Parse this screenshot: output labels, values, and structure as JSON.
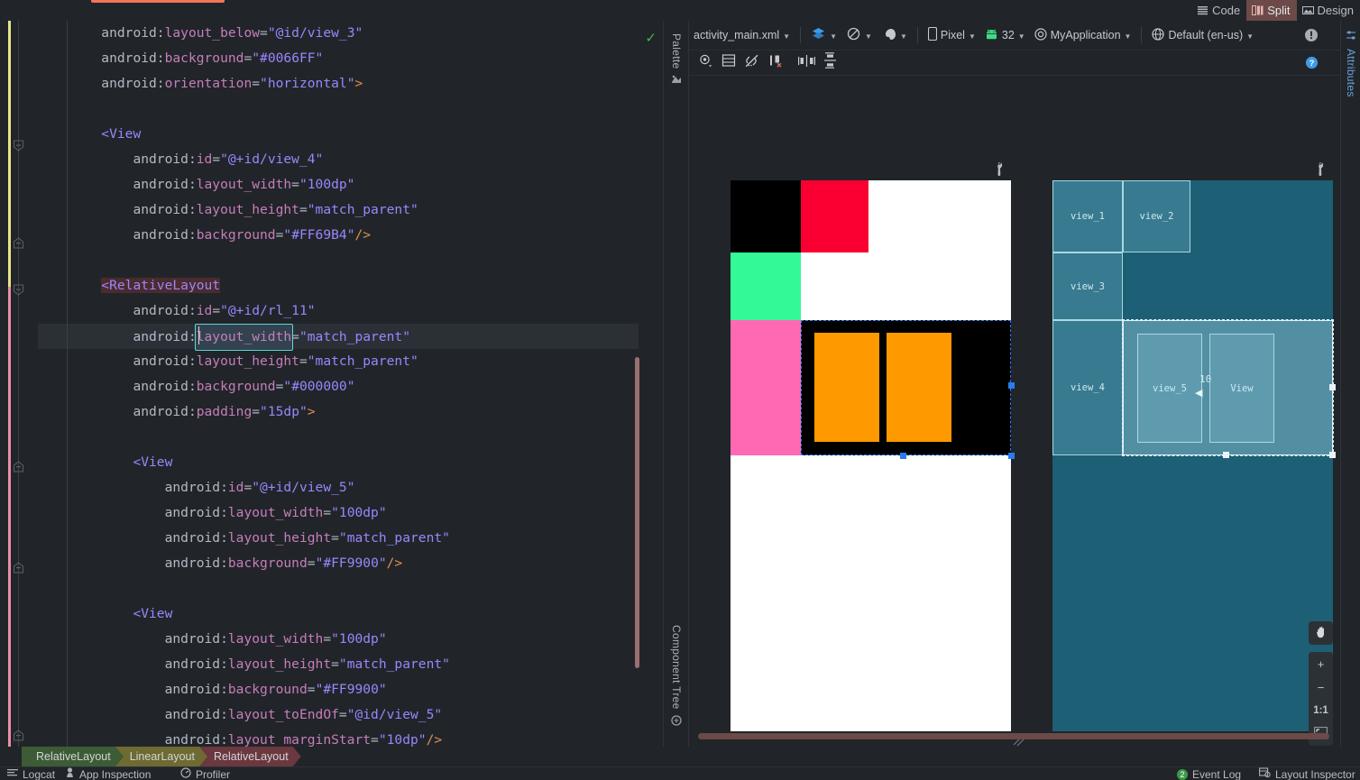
{
  "mode_tabs": [
    {
      "label": "Code",
      "icon": "code-lines-icon",
      "active": false
    },
    {
      "label": "Split",
      "icon": "split-pane-icon",
      "active": true
    },
    {
      "label": "Design",
      "icon": "design-image-icon",
      "active": false
    }
  ],
  "editor": {
    "lines": [
      {
        "indent": 2,
        "segments": [
          {
            "t": "android:",
            "c": "attr"
          },
          {
            "t": "layout_below",
            "c": "attrn"
          },
          {
            "t": "=",
            "c": "eq"
          },
          {
            "t": "\"@id/view_3\"",
            "c": "str"
          }
        ]
      },
      {
        "indent": 2,
        "segments": [
          {
            "t": "android:",
            "c": "attr"
          },
          {
            "t": "background",
            "c": "attrn"
          },
          {
            "t": "=",
            "c": "eq"
          },
          {
            "t": "\"#0066FF\"",
            "c": "str"
          }
        ]
      },
      {
        "indent": 2,
        "segments": [
          {
            "t": "android:",
            "c": "attr"
          },
          {
            "t": "orientation",
            "c": "attrn"
          },
          {
            "t": "=",
            "c": "eq"
          },
          {
            "t": "\"horizontal\"",
            "c": "str"
          },
          {
            "t": ">",
            "c": "gt"
          }
        ]
      },
      {
        "indent": 0,
        "segments": []
      },
      {
        "indent": 2,
        "segments": [
          {
            "t": "<View",
            "c": "tag"
          }
        ]
      },
      {
        "indent": 3,
        "segments": [
          {
            "t": "android:",
            "c": "attr"
          },
          {
            "t": "id",
            "c": "attrn"
          },
          {
            "t": "=",
            "c": "eq"
          },
          {
            "t": "\"@+id/view_4\"",
            "c": "str"
          }
        ]
      },
      {
        "indent": 3,
        "segments": [
          {
            "t": "android:",
            "c": "attr"
          },
          {
            "t": "layout_width",
            "c": "attrn"
          },
          {
            "t": "=",
            "c": "eq"
          },
          {
            "t": "\"100dp\"",
            "c": "str"
          }
        ]
      },
      {
        "indent": 3,
        "segments": [
          {
            "t": "android:",
            "c": "attr"
          },
          {
            "t": "layout_height",
            "c": "attrn"
          },
          {
            "t": "=",
            "c": "eq"
          },
          {
            "t": "\"match_parent\"",
            "c": "str"
          }
        ]
      },
      {
        "indent": 3,
        "segments": [
          {
            "t": "android:",
            "c": "attr"
          },
          {
            "t": "background",
            "c": "attrn"
          },
          {
            "t": "=",
            "c": "eq"
          },
          {
            "t": "\"#FF69B4\"",
            "c": "str"
          },
          {
            "t": "/>",
            "c": "gt"
          }
        ]
      },
      {
        "indent": 0,
        "segments": []
      },
      {
        "indent": 2,
        "segments": [
          {
            "t": "<RelativeLayout",
            "c": "tag hl"
          }
        ]
      },
      {
        "indent": 3,
        "segments": [
          {
            "t": "android:",
            "c": "attr"
          },
          {
            "t": "id",
            "c": "attrn"
          },
          {
            "t": "=",
            "c": "eq"
          },
          {
            "t": "\"@+id/rl_11\"",
            "c": "str"
          }
        ]
      },
      {
        "indent": 3,
        "selected": true,
        "segments": [
          {
            "t": "android:",
            "c": "attr"
          },
          {
            "t": "layout_width",
            "c": "attrn",
            "box": true
          },
          {
            "t": "=",
            "c": "eq"
          },
          {
            "t": "\"match_parent\"",
            "c": "str"
          }
        ]
      },
      {
        "indent": 3,
        "segments": [
          {
            "t": "android:",
            "c": "attr"
          },
          {
            "t": "layout_height",
            "c": "attrn"
          },
          {
            "t": "=",
            "c": "eq"
          },
          {
            "t": "\"match_parent\"",
            "c": "str"
          }
        ]
      },
      {
        "indent": 3,
        "segments": [
          {
            "t": "android:",
            "c": "attr"
          },
          {
            "t": "background",
            "c": "attrn"
          },
          {
            "t": "=",
            "c": "eq"
          },
          {
            "t": "\"#000000\"",
            "c": "str"
          }
        ]
      },
      {
        "indent": 3,
        "segments": [
          {
            "t": "android:",
            "c": "attr"
          },
          {
            "t": "padding",
            "c": "attrn"
          },
          {
            "t": "=",
            "c": "eq"
          },
          {
            "t": "\"15dp\"",
            "c": "str"
          },
          {
            "t": ">",
            "c": "gt"
          }
        ]
      },
      {
        "indent": 0,
        "segments": []
      },
      {
        "indent": 3,
        "segments": [
          {
            "t": "<View",
            "c": "tag"
          }
        ]
      },
      {
        "indent": 4,
        "segments": [
          {
            "t": "android:",
            "c": "attr"
          },
          {
            "t": "id",
            "c": "attrn"
          },
          {
            "t": "=",
            "c": "eq"
          },
          {
            "t": "\"@+id/view_5\"",
            "c": "str"
          }
        ]
      },
      {
        "indent": 4,
        "segments": [
          {
            "t": "android:",
            "c": "attr"
          },
          {
            "t": "layout_width",
            "c": "attrn"
          },
          {
            "t": "=",
            "c": "eq"
          },
          {
            "t": "\"100dp\"",
            "c": "str"
          }
        ]
      },
      {
        "indent": 4,
        "segments": [
          {
            "t": "android:",
            "c": "attr"
          },
          {
            "t": "layout_height",
            "c": "attrn"
          },
          {
            "t": "=",
            "c": "eq"
          },
          {
            "t": "\"match_parent\"",
            "c": "str"
          }
        ]
      },
      {
        "indent": 4,
        "segments": [
          {
            "t": "android:",
            "c": "attr"
          },
          {
            "t": "background",
            "c": "attrn"
          },
          {
            "t": "=",
            "c": "eq"
          },
          {
            "t": "\"#FF9900\"",
            "c": "str"
          },
          {
            "t": "/>",
            "c": "gt"
          }
        ]
      },
      {
        "indent": 0,
        "segments": []
      },
      {
        "indent": 3,
        "segments": [
          {
            "t": "<View",
            "c": "tag"
          }
        ]
      },
      {
        "indent": 4,
        "segments": [
          {
            "t": "android:",
            "c": "attr"
          },
          {
            "t": "layout_width",
            "c": "attrn"
          },
          {
            "t": "=",
            "c": "eq"
          },
          {
            "t": "\"100dp\"",
            "c": "str"
          }
        ]
      },
      {
        "indent": 4,
        "segments": [
          {
            "t": "android:",
            "c": "attr"
          },
          {
            "t": "layout_height",
            "c": "attrn"
          },
          {
            "t": "=",
            "c": "eq"
          },
          {
            "t": "\"match_parent\"",
            "c": "str"
          }
        ]
      },
      {
        "indent": 4,
        "segments": [
          {
            "t": "android:",
            "c": "attr"
          },
          {
            "t": "background",
            "c": "attrn"
          },
          {
            "t": "=",
            "c": "eq"
          },
          {
            "t": "\"#FF9900\"",
            "c": "str"
          }
        ]
      },
      {
        "indent": 4,
        "segments": [
          {
            "t": "android:",
            "c": "attr"
          },
          {
            "t": "layout_toEndOf",
            "c": "attrn"
          },
          {
            "t": "=",
            "c": "eq"
          },
          {
            "t": "\"@id/view_5\"",
            "c": "str"
          }
        ]
      },
      {
        "indent": 4,
        "segments": [
          {
            "t": "android:",
            "c": "attr"
          },
          {
            "t": "layout_marginStart",
            "c": "attrn"
          },
          {
            "t": "=",
            "c": "eq"
          },
          {
            "t": "\"10dp\"",
            "c": "str"
          },
          {
            "t": "/>",
            "c": "gt"
          }
        ]
      }
    ],
    "inspection_ok_icon": "checkmark-icon"
  },
  "left_tool_tabs": [
    {
      "label": "Palette",
      "icon": "palette-icon"
    },
    {
      "label": "Component Tree",
      "icon": "component-tree-icon"
    }
  ],
  "right_tool_tabs": [
    {
      "label": "Attributes",
      "icon": "attributes-icon"
    }
  ],
  "design_toolbar": {
    "file_name": "activity_main.xml",
    "view_mode_icons": [
      "design-surface-icon",
      "orientation-icon",
      "theme-icon"
    ],
    "device": "Pixel",
    "api_level": "32",
    "theme": "MyApplication",
    "locale": "Default (en-us)",
    "warning_icon": "warning-badge-icon",
    "help_icon": "help-circle-icon",
    "row2_icons": [
      "show-constraints-icon",
      "autoconnect-icon",
      "clear-constraints-icon",
      "infer-constraints-icon",
      "align-horizontal-icon",
      "align-vertical-icon"
    ]
  },
  "preview": {
    "surface_icon": "wrench-icon",
    "rendered_views": [
      {
        "name": "view_1",
        "color": "#000000"
      },
      {
        "name": "view_2",
        "color": "#FA0032"
      },
      {
        "name": "view_3",
        "color": "#33FA96"
      },
      {
        "name": "view_4",
        "color": "#FF69B4"
      },
      {
        "name": "rl_11",
        "color": "#000000"
      },
      {
        "name": "view_5",
        "color": "#FF9900"
      },
      {
        "name": "view_6",
        "color": "#FF9900"
      }
    ],
    "background": "#FFFFFF"
  },
  "blueprint": {
    "surface_icon": "wrench-icon",
    "labels": [
      "view_1",
      "view_2",
      "view_3",
      "view_4",
      "view_5",
      "View"
    ],
    "margin_label": "10"
  },
  "zoom_controls": {
    "pan_icon": "hand-pan-icon",
    "zoom_in": "+",
    "zoom_out": "−",
    "actual_size": "1:1",
    "fit_icon": "zoom-fit-icon"
  },
  "breadcrumbs": [
    {
      "label": "RelativeLayout",
      "color": "#3d5c35"
    },
    {
      "label": "LinearLayout",
      "color": "#6d6a32"
    },
    {
      "label": "RelativeLayout",
      "color": "#6b3840"
    }
  ],
  "status_bar": {
    "left_items": [
      {
        "label": "Logcat",
        "icon": "logcat-icon"
      },
      {
        "label": "App Inspection",
        "icon": "app-inspection-icon"
      },
      {
        "label": "Profiler",
        "icon": "profiler-icon"
      }
    ],
    "right_items": [
      {
        "label": "Event Log",
        "icon": "event-log-icon",
        "badge": "2"
      },
      {
        "label": "Layout Inspector",
        "icon": "layout-inspector-icon"
      }
    ]
  }
}
